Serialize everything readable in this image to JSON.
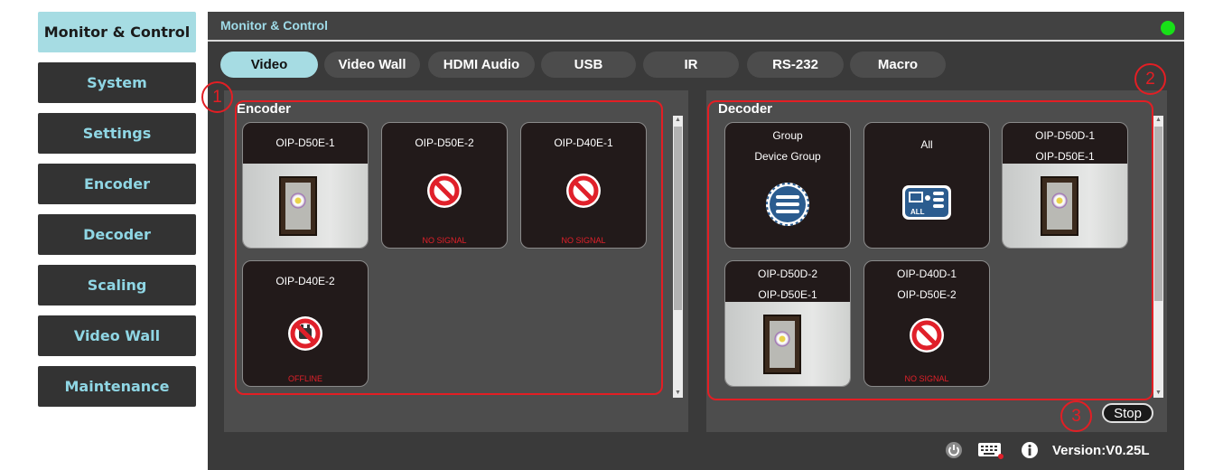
{
  "sidebar": {
    "items": [
      {
        "label": "Monitor & Control",
        "active": true
      },
      {
        "label": "System"
      },
      {
        "label": "Settings"
      },
      {
        "label": "Encoder"
      },
      {
        "label": "Decoder"
      },
      {
        "label": "Scaling"
      },
      {
        "label": "Video Wall"
      },
      {
        "label": "Maintenance"
      }
    ]
  },
  "header": {
    "title": "Monitor & Control",
    "status_color": "#18e018"
  },
  "tabs": [
    "Video",
    "Video Wall",
    "HDMI Audio",
    "USB",
    "IR",
    "RS-232",
    "Macro"
  ],
  "encoder": {
    "title": "Encoder",
    "tiles": [
      {
        "line1": "OIP-D50E-1",
        "status": "",
        "icon": "video-preview"
      },
      {
        "line1": "OIP-D50E-2",
        "status": "NO SIGNAL",
        "icon": "no-signal-icon"
      },
      {
        "line1": "OIP-D40E-1",
        "status": "NO SIGNAL",
        "icon": "no-signal-icon"
      },
      {
        "line1": "OIP-D40E-2",
        "status": "OFFLINE",
        "icon": "offline-icon"
      }
    ]
  },
  "decoder": {
    "title": "Decoder",
    "tiles": [
      {
        "line1": "Group",
        "line2": "Device Group",
        "icon": "device-group-icon"
      },
      {
        "line1": "All",
        "line2": "",
        "icon": "all-devices-icon",
        "badge": "ALL"
      },
      {
        "line1": "OIP-D50D-1",
        "line2": "OIP-D50E-1",
        "icon": "video-preview"
      },
      {
        "line1": "OIP-D50D-2",
        "line2": "OIP-D50E-1",
        "icon": "video-preview"
      },
      {
        "line1": "OIP-D40D-1",
        "line2": "OIP-D50E-2",
        "status": "NO SIGNAL",
        "icon": "no-signal-icon"
      }
    ]
  },
  "markers": [
    "1",
    "2",
    "3"
  ],
  "controls": {
    "stop_label": "Stop"
  },
  "footer": {
    "version": "Version:V0.25L"
  },
  "colors": {
    "accent": "#a6dce3",
    "highlight": "#e31e24",
    "status_red": "#e0202a"
  }
}
